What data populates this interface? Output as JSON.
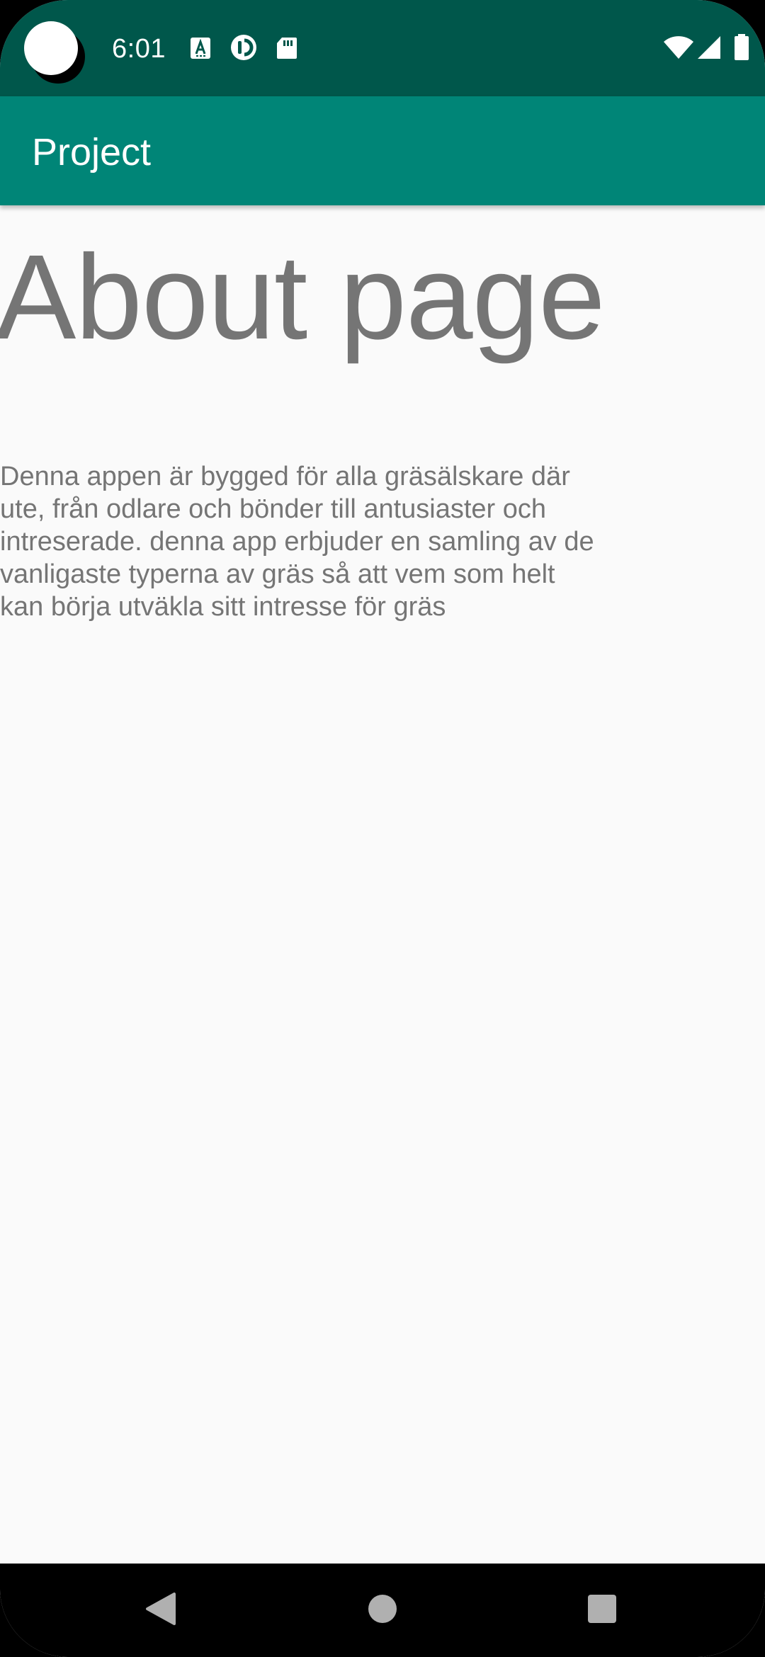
{
  "status_bar": {
    "time": "6:01",
    "notification_icons": [
      "text-a-icon",
      "data-saver-icon",
      "sd-card-icon"
    ],
    "system_icons": [
      "wifi-icon",
      "cellular-signal-icon",
      "battery-icon"
    ]
  },
  "app_bar": {
    "title": "Project"
  },
  "main": {
    "heading": "About page",
    "body": "Denna appen är bygged för alla gräsälskare där ute, från odlare och bönder till antusiaster och intreserade. denna app erbjuder en samling av de vanligaste typerna av gräs så att vem som helt kan börja utväkla sitt intresse för gräs"
  },
  "nav_bar": {
    "buttons": [
      "back-icon",
      "home-icon",
      "recents-icon"
    ]
  },
  "colors": {
    "status_bar": "#00574b",
    "app_bar": "#008577",
    "background": "#fafafa",
    "text": "#757575"
  }
}
